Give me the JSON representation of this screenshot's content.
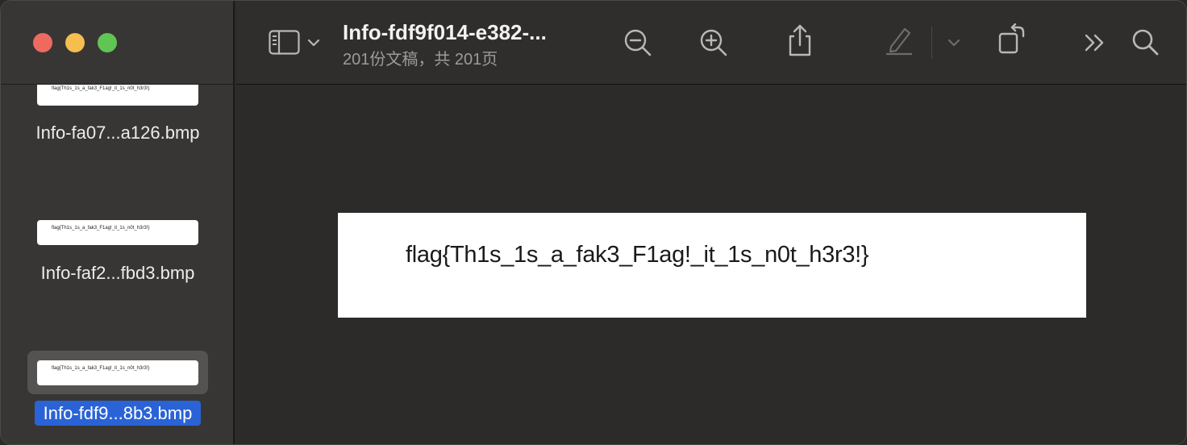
{
  "window": {
    "title": "Info-fdf9f014-e382-...",
    "subtitle": "201份文稿，共 201页"
  },
  "sidebar": {
    "items": [
      {
        "label": "Info-fa07...a126.bmp",
        "thumb_text": "flag{Th1s_1s_a_fak3_F1ag!_it_1s_n0t_h3r3!}",
        "selected": false
      },
      {
        "label": "Info-faf2...fbd3.bmp",
        "thumb_text": "flag{Th1s_1s_a_fak3_F1ag!_it_1s_n0t_h3r3!}",
        "selected": false
      },
      {
        "label": "Info-fdf9...8b3.bmp",
        "thumb_text": "flag{Th1s_1s_a_fak3_F1ag!_it_1s_n0t_h3r3!}",
        "selected": true
      }
    ]
  },
  "toolbar": {
    "icons": [
      "sidebar-icon",
      "chevron-down-icon",
      "zoom-out-icon",
      "zoom-in-icon",
      "share-icon",
      "markup-pen-icon",
      "chevron-down-icon",
      "rotate-icon",
      "more-icon",
      "search-icon"
    ]
  },
  "document": {
    "text": "flag{Th1s_1s_a_fak3_F1ag!_it_1s_n0t_h3r3!}"
  },
  "colors": {
    "selection": "#2a63d6",
    "close": "#ee6a5f",
    "minimize": "#f5be4f",
    "zoom": "#61c554"
  }
}
